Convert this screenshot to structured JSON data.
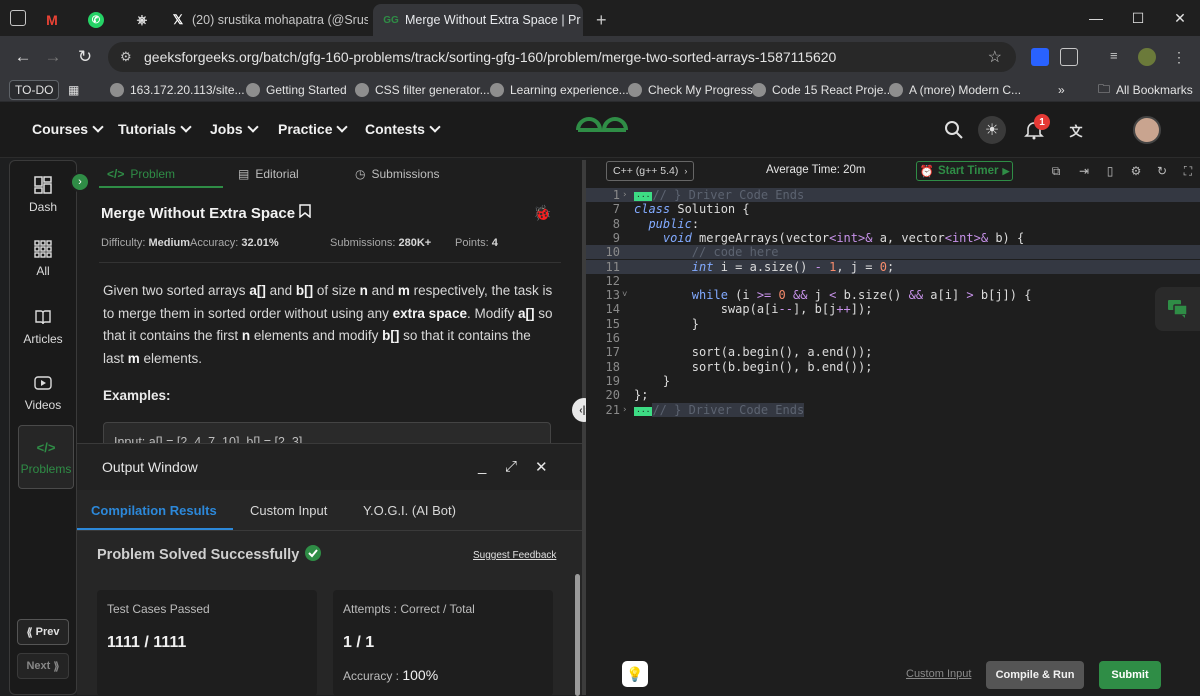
{
  "browser": {
    "tabs": [
      {
        "label": "",
        "icon": "gmail-icon",
        "color": "#ea4335"
      },
      {
        "label": "",
        "icon": "whatsapp-icon",
        "color": "#25d366"
      },
      {
        "label": "",
        "icon": "chatgpt-icon",
        "color": "#e3e3e3"
      },
      {
        "label": "(20) srustika mohapatra (@Srus",
        "icon": "x-icon",
        "color": "#ffffff"
      },
      {
        "label": "Merge Without Extra Space | Pr",
        "icon": "gfg-icon",
        "color": "#2f8d46"
      }
    ],
    "url": "geeksforgeeks.org/batch/gfg-160-problems/track/sorting-gfg-160/problem/merge-two-sorted-arrays-1587115620",
    "bookmarks": [
      "TO-DO",
      "163.172.20.113/site...",
      "Getting Started",
      "CSS filter generator...",
      "Learning experience...",
      "Check My Progress",
      "Code 15 React Proje...",
      "A (more) Modern C..."
    ],
    "all_bookmarks": "All Bookmarks"
  },
  "gfg_nav": {
    "items": [
      "Courses",
      "Tutorials",
      "Jobs",
      "Practice",
      "Contests"
    ],
    "logo": "GG",
    "notification_count": "1",
    "brand_color": "#2f8d46"
  },
  "sidebar": {
    "items": [
      "Dash",
      "All",
      "Articles",
      "Videos",
      "Problems"
    ],
    "prev": "Prev",
    "next": "Next"
  },
  "problem": {
    "tabs": [
      "Problem",
      "Editorial",
      "Submissions"
    ],
    "title": "Merge Without Extra Space",
    "difficulty_label": "Difficulty:",
    "difficulty": "Medium",
    "accuracy_label": "Accuracy:",
    "accuracy": "32.01%",
    "submissions_label": "Submissions:",
    "submissions": "280K+",
    "points_label": "Points:",
    "points": "4",
    "desc": {
      "p1": "Given two sorted arrays ",
      "a": "a[]",
      "p2": " and ",
      "b": "b[]",
      "p3": " of size ",
      "n": "n",
      "p4": " and ",
      "m": "m",
      "p5": " respectively, the task is to merge them in sorted order without using any ",
      "extra": "extra space",
      "p6": ". Modify ",
      "a2": "a[]",
      "p7": " so that it contains the first ",
      "n2": "n",
      "p8": " elements and modify ",
      "b2": "b[]",
      "p9": " so that it contains the last ",
      "m2": "m",
      "p10": " elements."
    },
    "examples_heading": "Examples:",
    "example_line": "Input: a[] = [2, 4, 7, 10], b[] = [2, 3]"
  },
  "output": {
    "title": "Output Window",
    "tabs": [
      "Compilation Results",
      "Custom Input",
      "Y.O.G.I. (AI Bot)"
    ],
    "status": "Problem Solved Successfully",
    "feedback": "Suggest Feedback",
    "card1_title": "Test Cases Passed",
    "card1_value": "1111 / 1111",
    "card2_title": "Attempts : Correct / Total",
    "card2_value": "1 / 1",
    "accuracy_label": "Accuracy :",
    "accuracy_value": "100%"
  },
  "editor": {
    "language": "C++ (g++ 5.4)",
    "average_time": "Average Time: 20m",
    "start_timer": "Start Timer",
    "lines": [
      {
        "n": "1",
        "fold": "›",
        "hl": true
      },
      {
        "n": "7",
        "fold": "",
        "hl": false
      },
      {
        "n": "8",
        "fold": "",
        "hl": false
      },
      {
        "n": "9",
        "fold": "",
        "hl": false
      },
      {
        "n": "10",
        "fold": "",
        "hl": true
      },
      {
        "n": "11",
        "fold": "",
        "hl": true
      },
      {
        "n": "12",
        "fold": "",
        "hl": false
      },
      {
        "n": "13",
        "fold": "˅",
        "hl": false
      },
      {
        "n": "14",
        "fold": "",
        "hl": false
      },
      {
        "n": "15",
        "fold": "",
        "hl": false
      },
      {
        "n": "16",
        "fold": "",
        "hl": false
      },
      {
        "n": "17",
        "fold": "",
        "hl": false
      },
      {
        "n": "18",
        "fold": "",
        "hl": false
      },
      {
        "n": "19",
        "fold": "",
        "hl": false
      },
      {
        "n": "20",
        "fold": "",
        "hl": false
      },
      {
        "n": "21",
        "fold": "›",
        "hl": false
      }
    ],
    "custom_input": "Custom Input",
    "compile_run": "Compile & Run",
    "submit": "Submit"
  }
}
